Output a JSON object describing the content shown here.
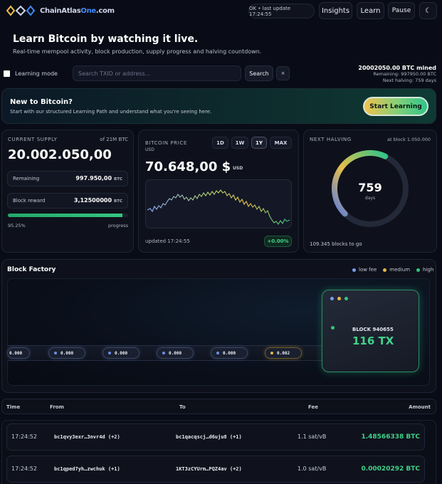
{
  "brand": {
    "name_main": "ChainAtlas",
    "name_accent": "One",
    "name_suffix": ".com"
  },
  "header": {
    "status": "OK • last update 17:24:55",
    "insights": "Insights",
    "learn": "Learn",
    "pause": "Pause",
    "theme_icon": "☾"
  },
  "hero": {
    "title": "Learn Bitcoin by watching it live.",
    "subtitle": "Real-time mempool activity, block production, supply progress and halving countdown."
  },
  "controls": {
    "learning_mode": "Learning mode",
    "search_placeholder": "Search TXID or address...",
    "search_button": "Search",
    "clear_button": "×"
  },
  "mined": {
    "headline": "20002050.00 BTC mined",
    "remaining": "Remaining: 997950.00 BTC",
    "next_halving": "Next halving: 759 days"
  },
  "banner": {
    "title": "New to Bitcoin?",
    "text": "Start with our structured Learning Path and understand what you're seeing here.",
    "button": "Start Learning"
  },
  "supply": {
    "label": "CURRENT SUPPLY",
    "of_total": "of 21M BTC",
    "value": "20.002.050,00",
    "remaining_label": "Remaining",
    "remaining_value": "997.950,00",
    "reward_label": "Block reward",
    "reward_value": "3,12500000",
    "unit": "BTC",
    "progress_pct": "95.25%",
    "progress_fraction": 0.9525,
    "progress_label": "progress"
  },
  "price": {
    "label": "BITCOIN PRICE",
    "currency": "USD",
    "ranges": [
      "1D",
      "1W",
      "1Y",
      "MAX"
    ],
    "active_range": "1Y",
    "value": "70.648,00 $",
    "unit": "USD",
    "updated": "updated 17:24:55",
    "change": "+0.00%"
  },
  "halving": {
    "label": "NEXT HALVING",
    "at_block": "at block 1.050.000",
    "days": "759",
    "days_unit": "days",
    "blocks_to_go": "109.345 blocks to go"
  },
  "factory": {
    "title": "Block Factory",
    "legend": [
      {
        "label": "low fee",
        "color": "#7b9cf0"
      },
      {
        "label": "medium",
        "color": "#e8b84a"
      },
      {
        "label": "high",
        "color": "#35c57f"
      }
    ],
    "pills": [
      "0.000",
      "0.000",
      "0.000",
      "0.000",
      "0.000",
      "0.002"
    ],
    "block_label": "BLOCK 940655",
    "block_tx": "116 TX"
  },
  "table": {
    "headers": {
      "time": "Time",
      "from": "From",
      "to": "To",
      "fee": "Fee",
      "amount": "Amount"
    },
    "rows": [
      {
        "time": "17:24:52",
        "from": "bc1qvy3exr…3nvr4d (+2)",
        "to": "bc1qacqscj…d6uju8 (+1)",
        "fee": "1.1 sat/vB",
        "amount": "1.48566338 BTC"
      },
      {
        "time": "17:24:52",
        "from": "bc1qped7yh…zwchuk (+1)",
        "to": "1KT3zCYUrm…PQZ4av (+2)",
        "fee": "1.0 sat/vB",
        "amount": "0.00020292 BTC"
      }
    ]
  },
  "colors": {
    "accent_green": "#3fd38a",
    "accent_blue": "#3f8cff",
    "accent_yellow": "#f2c14e"
  }
}
